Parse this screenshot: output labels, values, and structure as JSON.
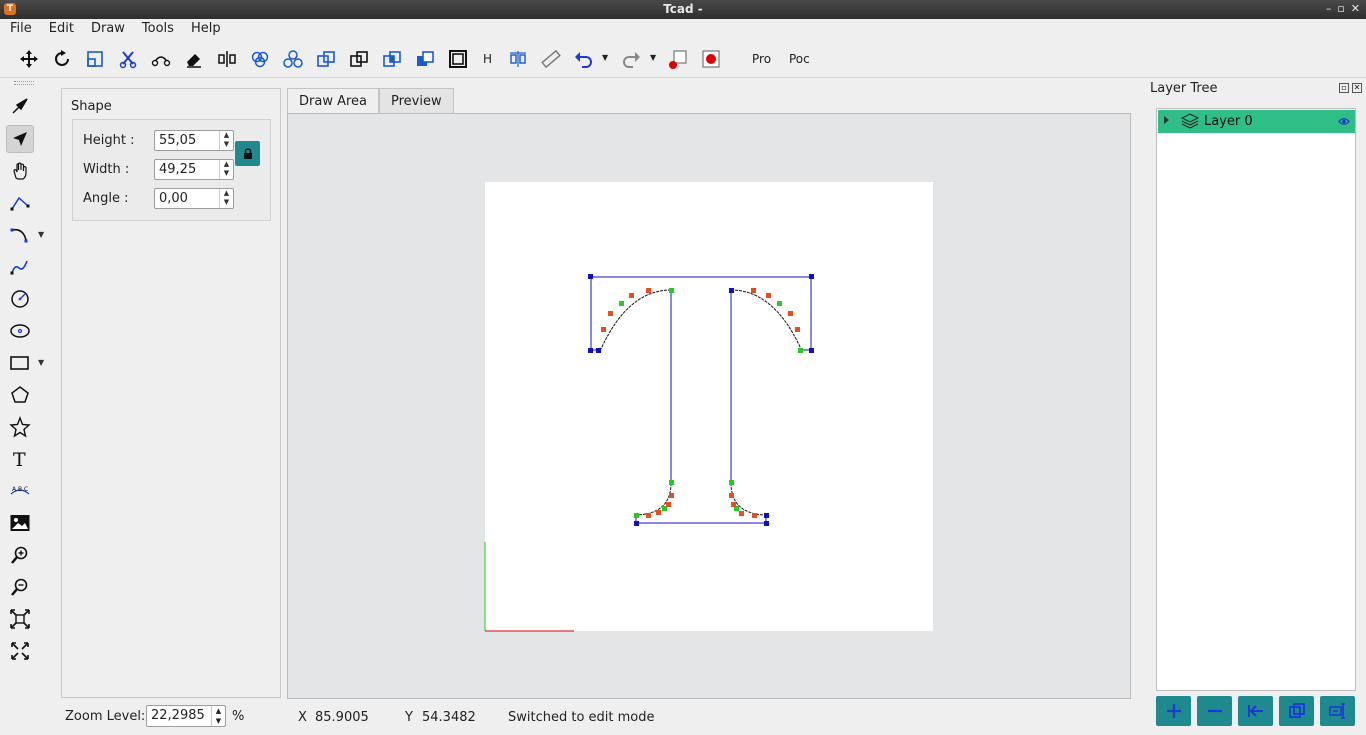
{
  "window": {
    "title": "Tcad -",
    "logo": "T"
  },
  "menu": [
    "File",
    "Edit",
    "Draw",
    "Tools",
    "Help"
  ],
  "toolbar": {
    "text_h": "H",
    "text_pro": "Pro",
    "text_poc": "Poc"
  },
  "shape_panel": {
    "title": "Shape",
    "height_label": "Height :",
    "height_value": "55,05",
    "width_label": "Width :",
    "width_value": "49,25",
    "angle_label": "Angle :",
    "angle_value": "0,00"
  },
  "tabs": [
    "Draw Area",
    "Preview"
  ],
  "layer_tree": {
    "title": "Layer Tree",
    "layers": [
      {
        "name": "Layer 0"
      }
    ]
  },
  "status": {
    "zoom_label": "Zoom Level:",
    "zoom_value": "22,2985",
    "zoom_unit": "%",
    "x_label": "X",
    "x_value": "85.9005",
    "y_label": "Y",
    "y_value": "54.3482",
    "message": "Switched to edit mode"
  },
  "colors": {
    "accent": "#1e8a8f",
    "layer_selected": "#2fbe86",
    "bbox_blue": "#1010c0",
    "node_green": "#22cc22",
    "node_orange": "#e65020"
  }
}
